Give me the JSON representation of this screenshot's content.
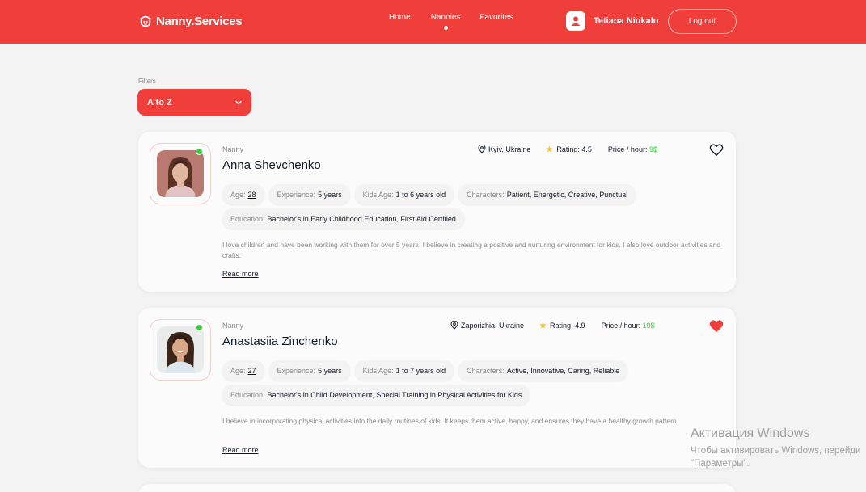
{
  "header": {
    "logo_text": "Nanny.Services",
    "nav": [
      {
        "label": "Home",
        "active": false
      },
      {
        "label": "Nannies",
        "active": true
      },
      {
        "label": "Favorites",
        "active": false
      }
    ],
    "user_name": "Tetiana Niukalo",
    "logout_label": "Log out",
    "brand_color": "#f03f3b"
  },
  "filters": {
    "label": "Filters",
    "selected": "A to Z"
  },
  "cards": [
    {
      "role": "Nanny",
      "name": "Anna Shevchenko",
      "location": "Kyiv, Ukraine",
      "rating_label": "Rating:",
      "rating": "4.5",
      "price_label": "Price / hour:",
      "price": "9$",
      "favorite": false,
      "online": true,
      "age_label": "Age:",
      "age": "28",
      "experience_label": "Experience:",
      "experience": "5 years",
      "kids_age_label": "Kids Age:",
      "kids_age": "1 to 6 years old",
      "characters_label": "Characters:",
      "characters": "Patient, Energetic, Creative, Punctual",
      "education_label": "Education:",
      "education": "Bachelor's in Early Childhood Education, First Aid Certified",
      "about": "I love children and have been working with them for over 5 years. I believe in creating a positive and nurturing environment for kids. I also love outdoor activities and crafts.",
      "read_more": "Read more"
    },
    {
      "role": "Nanny",
      "name": "Anastasiia Zinchenko",
      "location": "Zaporizhia, Ukraine",
      "rating_label": "Rating:",
      "rating": "4.9",
      "price_label": "Price / hour:",
      "price": "19$",
      "favorite": true,
      "online": true,
      "age_label": "Age:",
      "age": "27",
      "experience_label": "Experience:",
      "experience": "5 years",
      "kids_age_label": "Kids Age:",
      "kids_age": "1 to 7 years old",
      "characters_label": "Characters:",
      "characters": "Active, Innovative, Caring, Reliable",
      "education_label": "Education:",
      "education": "Bachelor's in Child Development, Special Training in Physical Activities for Kids",
      "about": "I believe in incorporating physical activities into the daily routines of kids. It keeps them active, happy, and ensures they have a healthy growth pattern.",
      "read_more": "Read more"
    }
  ],
  "watermark": {
    "title": "Активация Windows",
    "line1": "Чтобы активировать Windows, перейди",
    "line2": "\"Параметры\"."
  }
}
